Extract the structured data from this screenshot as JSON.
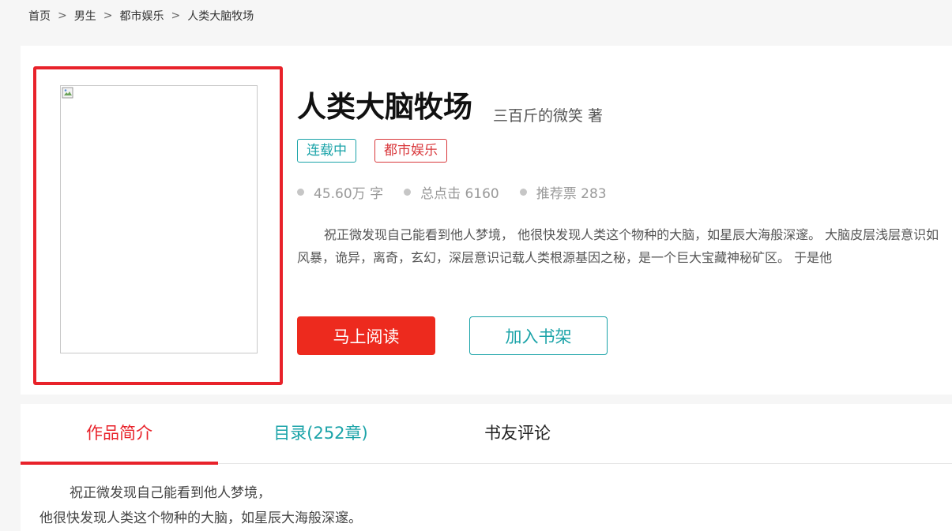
{
  "breadcrumb": {
    "items": [
      "首页",
      "男生",
      "都市娱乐",
      "人类大脑牧场"
    ],
    "separator": ">"
  },
  "book": {
    "title": "人类大脑牧场",
    "author": "三百斤的微笑 著",
    "status_tag": "连载中",
    "genre_tag": "都市娱乐",
    "stats": {
      "words": "45.60万 字",
      "clicks": "总点击 6160",
      "recommend": "推荐票 283"
    },
    "summary": "祝正微发现自己能看到他人梦境， 他很快发现人类这个物种的大脑，如星辰大海般深邃。 大脑皮层浅层意识如风暴，诡异，离奇，玄幻，深层意识记载人类根源基因之秘，是一个巨大宝藏神秘矿区。 于是他",
    "read_button": "马上阅读",
    "shelf_button": "加入书架"
  },
  "tabs": {
    "intro": "作品简介",
    "catalog": "目录(252章)",
    "comments": "书友评论"
  },
  "intro": {
    "line1": "祝正微发现自己能看到他人梦境，",
    "line2": "他很快发现人类这个物种的大脑，如星辰大海般深邃。"
  },
  "colors": {
    "accent_red": "#e8222a",
    "accent_teal": "#1aa3a8"
  }
}
